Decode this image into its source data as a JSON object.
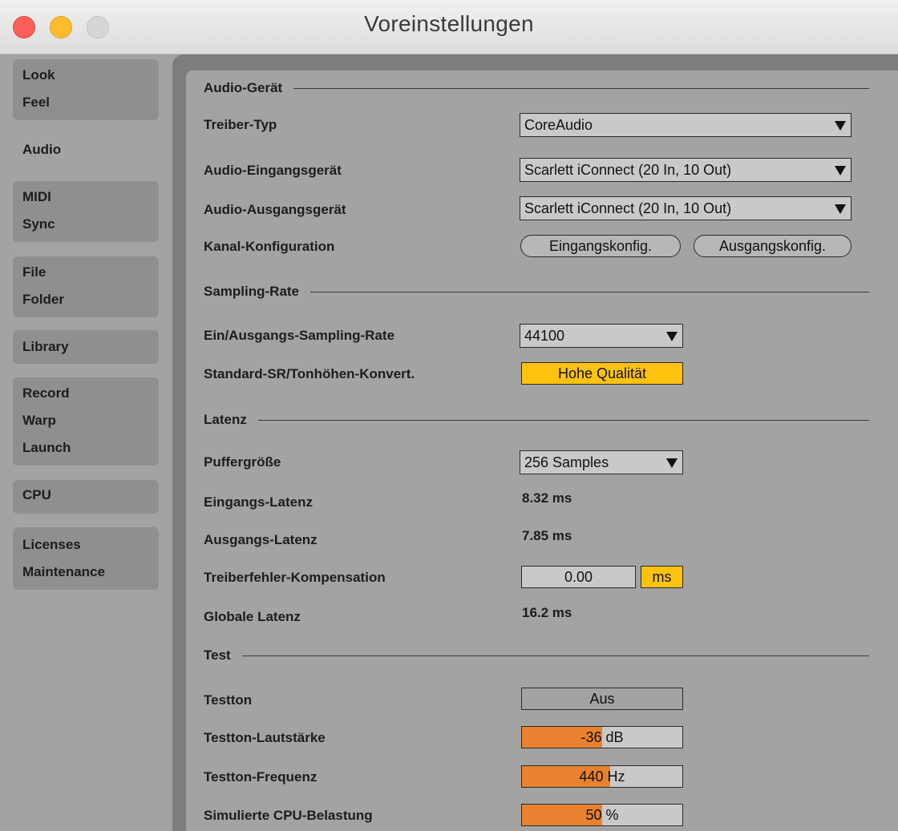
{
  "window": {
    "title": "Voreinstellungen"
  },
  "sidebar": {
    "groups": [
      {
        "items": [
          "Look",
          "Feel"
        ]
      },
      {
        "items": [
          "Audio"
        ],
        "active": true
      },
      {
        "items": [
          "MIDI",
          "Sync"
        ]
      },
      {
        "items": [
          "File",
          "Folder"
        ]
      },
      {
        "items": [
          "Library"
        ]
      },
      {
        "items": [
          "Record",
          "Warp",
          "Launch"
        ]
      },
      {
        "items": [
          "CPU"
        ]
      },
      {
        "items": [
          "Licenses",
          "Maintenance"
        ]
      }
    ]
  },
  "sections": {
    "audio_device": "Audio-Gerät",
    "sampling_rate": "Sampling-Rate",
    "latency": "Latenz",
    "test": "Test"
  },
  "audio_device": {
    "driver_type_label": "Treiber-Typ",
    "driver_type_value": "CoreAudio",
    "input_device_label": "Audio-Eingangsgerät",
    "input_device_value": "Scarlett iConnect (20 In, 10 Out)",
    "output_device_label": "Audio-Ausgangsgerät",
    "output_device_value": "Scarlett iConnect (20 In, 10 Out)",
    "channel_config_label": "Kanal-Konfiguration",
    "input_config_button": "Eingangskonfig.",
    "output_config_button": "Ausgangskonfig."
  },
  "sampling_rate": {
    "rate_label": "Ein/Ausgangs-Sampling-Rate",
    "rate_value": "44100",
    "conversion_label": "Standard-SR/Tonhöhen-Konvert.",
    "conversion_value": "Hohe Qualität"
  },
  "latency": {
    "buffer_label": "Puffergröße",
    "buffer_value": "256 Samples",
    "input_latency_label": "Eingangs-Latenz",
    "input_latency_value": "8.32 ms",
    "output_latency_label": "Ausgangs-Latenz",
    "output_latency_value": "7.85 ms",
    "driver_comp_label": "Treiberfehler-Kompensation",
    "driver_comp_value": "0.00",
    "driver_comp_unit": "ms",
    "global_latency_label": "Globale Latenz",
    "global_latency_value": "16.2 ms"
  },
  "test": {
    "tone_label": "Testton",
    "tone_value": "Aus",
    "volume_label": "Testton-Lautstärke",
    "volume_value": "-36 dB",
    "volume_fill": 0.5,
    "frequency_label": "Testton-Frequenz",
    "frequency_value": "440 Hz",
    "frequency_fill": 0.55,
    "cpu_label": "Simulierte CPU-Belastung",
    "cpu_value": "50 %",
    "cpu_fill": 0.5
  },
  "colors": {
    "accent_yellow": "#ffc20e",
    "slider_orange": "#e8822e",
    "panel_gray": "#a3a3a3"
  }
}
